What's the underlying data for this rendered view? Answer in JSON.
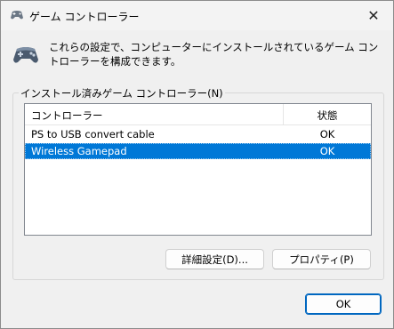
{
  "window": {
    "title": "ゲーム コントローラー",
    "close_glyph": "✕"
  },
  "description": "これらの設定で、コンピューターにインストールされているゲーム コントローラーを構成できます。",
  "group": {
    "label": "インストール済みゲーム コントローラー(N)"
  },
  "list": {
    "columns": [
      "コントローラー",
      "状態"
    ],
    "rows": [
      {
        "name": "PS to USB convert cable",
        "status": "OK",
        "selected": false
      },
      {
        "name": "Wireless Gamepad",
        "status": "OK",
        "selected": true
      }
    ]
  },
  "buttons": {
    "advanced": "詳細設定(D)...",
    "properties": "プロパティ(P)",
    "ok": "OK"
  },
  "icons": {
    "title": "gamepad-icon",
    "header": "gamepad-icon"
  },
  "colors": {
    "selection": "#0078d7",
    "default_button_border": "#0067c0"
  }
}
